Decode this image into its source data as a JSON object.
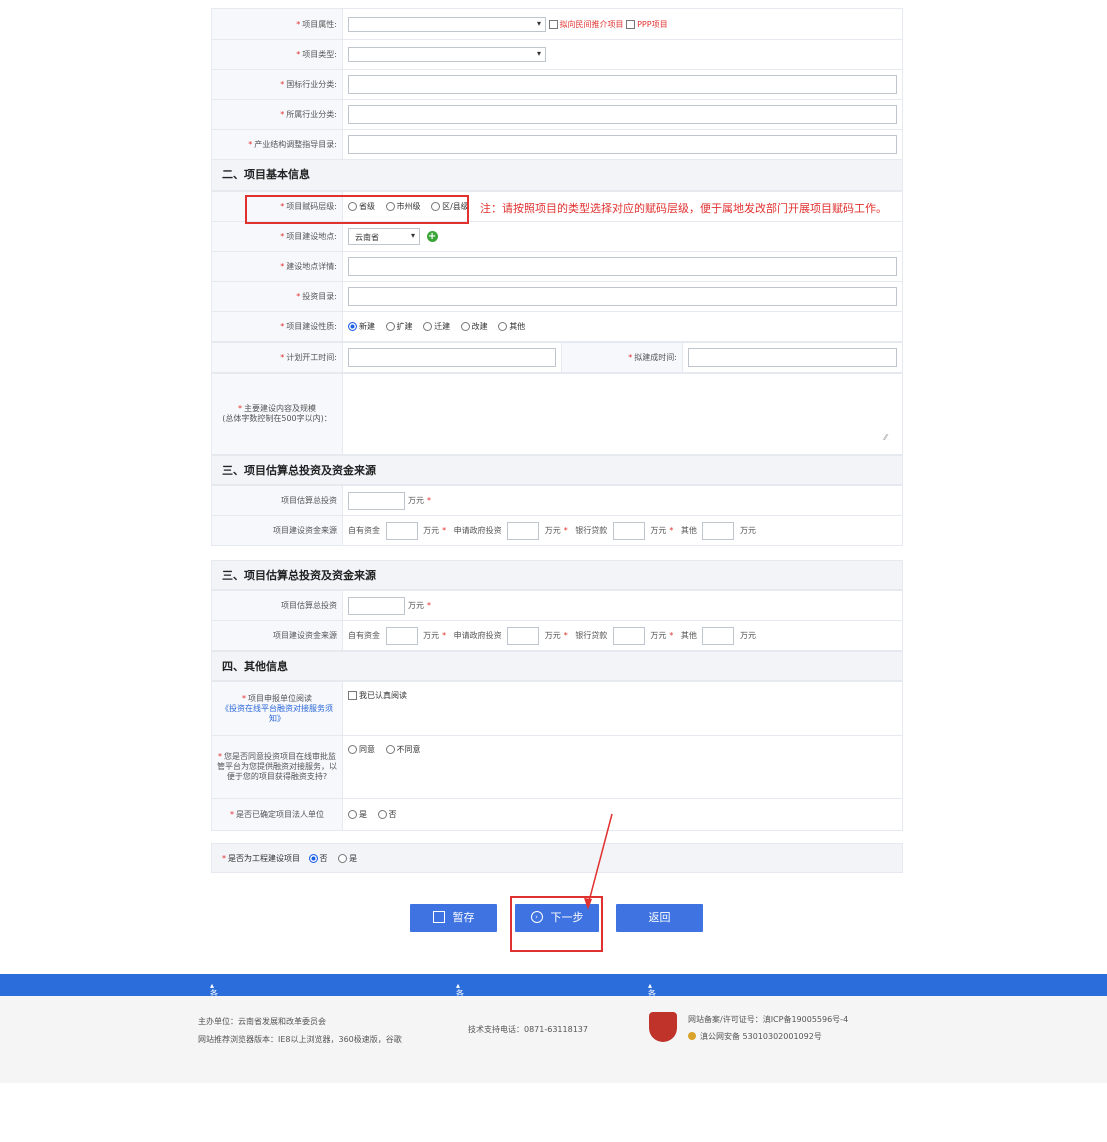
{
  "row_labels": {
    "project_attr": "项目属性:",
    "project_type": "项目类型:",
    "industry_national": "国标行业分类:",
    "industry_own": "所属行业分类:",
    "industry_structure": "产业结构调整指导目录:",
    "code_level": "项目赋码层级:",
    "location": "项目建设地点:",
    "location_detail": "建设地点详情:",
    "invest_catalog": "投资目录:",
    "nature": "项目建设性质:",
    "start_time": "计划开工时间:",
    "end_time": "拟建成时间:",
    "content_scale": "主要建设内容及规模\n(总体字数控制在500字以内)："
  },
  "checks": {
    "private_capital": "拟向民间推介项目",
    "ppp": "PPP项目"
  },
  "sections": {
    "basic": "二、项目基本信息",
    "invest1": "三、项目估算总投资及资金来源",
    "invest2": "三、项目估算总投资及资金来源",
    "other": "四、其他信息"
  },
  "code_level_options": [
    "省级",
    "市州级",
    "区/县级"
  ],
  "annotation": "注：请按照项目的类型选择对应的赋码层级，便于属地发改部门开展项目赋码工作。",
  "province_select": "云南省",
  "nature_options": [
    "新建",
    "扩建",
    "迁建",
    "改建",
    "其他"
  ],
  "invest": {
    "total_label": "项目估算总投资",
    "fund_label": "项目建设资金来源",
    "unit": "万元",
    "self_fund": "自有资金",
    "gov_invest": "申请政府投资",
    "bank_loan": "银行贷款",
    "other": "其他"
  },
  "other_info": {
    "read_label_1": "项目申报单位阅读",
    "read_label_2": "《投资在线平台融资对接服务须知》",
    "read_check": "我已认真阅读",
    "agree_label": "您是否同意投资项目在线审批监管平台为您提供融资对接服务，以便于您的项目获得融资支持?",
    "agree_options": [
      "同意",
      "不同意"
    ],
    "legal_label": "是否已确定项目法人单位",
    "legal_options": [
      "是",
      "否"
    ],
    "eng_label": "是否为工程建设项目",
    "eng_options": [
      "否",
      "是"
    ]
  },
  "buttons": {
    "save": "暂存",
    "next": "下一步",
    "back": "返回"
  },
  "footer_bar": {
    "link1": "各省投资项目在线审批监管平台",
    "link2": "各省政务服务网",
    "link3": "各级投资审批中介超市"
  },
  "footer": {
    "host": "主办单位：云南省发展和改革委员会",
    "browser": "网站推荐浏览器版本：IE8以上浏览器，360极速版，谷歌",
    "support": "技术支持电话：0871-63118137",
    "icp": "网站备案/许可证号：滇ICP备19005596号-4",
    "police": "滇公网安备 53010302001092号"
  },
  "colors": {
    "accent": "#3f73e2",
    "required": "#e0312f",
    "footer_bar": "#2c6ddc"
  }
}
